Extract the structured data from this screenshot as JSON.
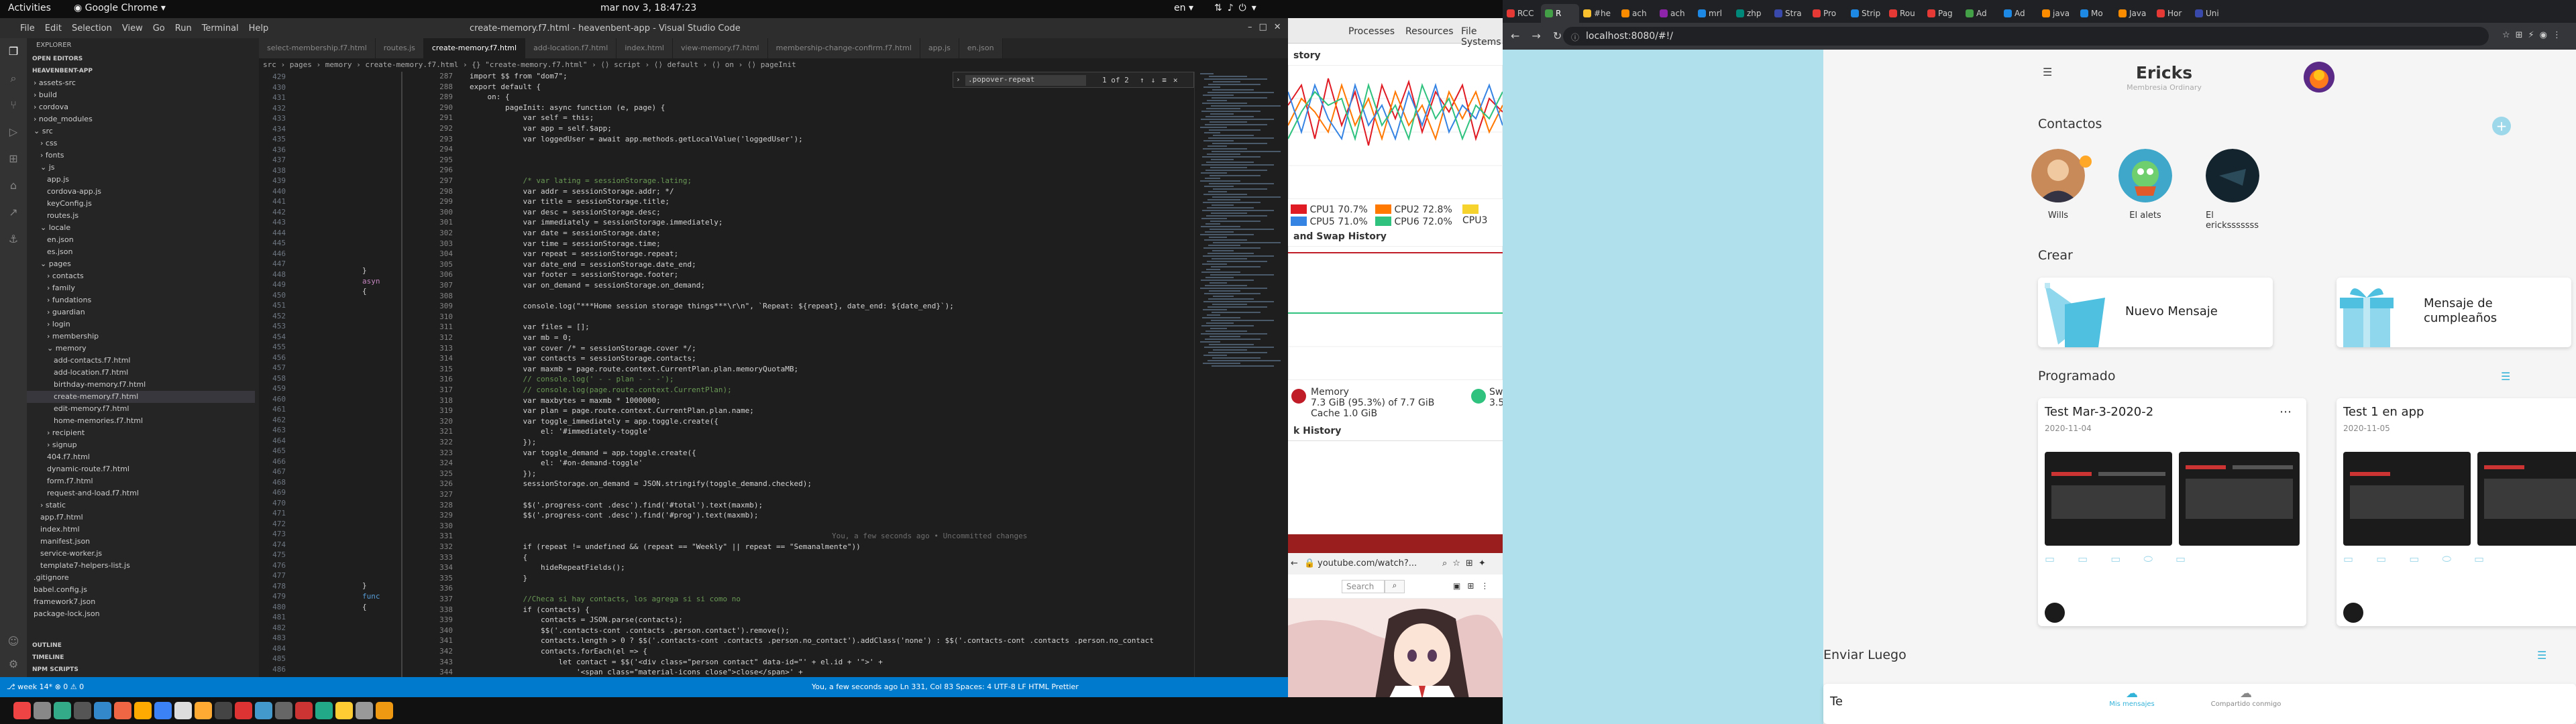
{
  "topbar": {
    "activities": "Activities",
    "app_name": "Google Chrome",
    "clock": "mar nov  3, 18:47:23",
    "lang": "en"
  },
  "vscode": {
    "window_title": "create-memory.f7.html - heavenbent-app - Visual Studio Code",
    "menu": [
      "File",
      "Edit",
      "Selection",
      "View",
      "Go",
      "Run",
      "Terminal",
      "Help"
    ],
    "explorer_title": "EXPLORER",
    "open_editors": "OPEN EDITORS",
    "project": "HEAVENBENT-APP",
    "tree": [
      {
        "label": "› assets-src",
        "depth": 1
      },
      {
        "label": "› build",
        "depth": 1
      },
      {
        "label": "› cordova",
        "depth": 1
      },
      {
        "label": "› node_modules",
        "depth": 1
      },
      {
        "label": "⌄ src",
        "depth": 1
      },
      {
        "label": "› css",
        "depth": 2
      },
      {
        "label": "› fonts",
        "depth": 2
      },
      {
        "label": "⌄ js",
        "depth": 2
      },
      {
        "label": "app.js",
        "depth": 3
      },
      {
        "label": "cordova-app.js",
        "depth": 3
      },
      {
        "label": "keyConfig.js",
        "depth": 3
      },
      {
        "label": "routes.js",
        "depth": 3
      },
      {
        "label": "⌄ locale",
        "depth": 2
      },
      {
        "label": "en.json",
        "depth": 3
      },
      {
        "label": "es.json",
        "depth": 3
      },
      {
        "label": "⌄ pages",
        "depth": 2
      },
      {
        "label": "› contacts",
        "depth": 3
      },
      {
        "label": "› family",
        "depth": 3
      },
      {
        "label": "› fundations",
        "depth": 3
      },
      {
        "label": "› guardian",
        "depth": 3
      },
      {
        "label": "› login",
        "depth": 3
      },
      {
        "label": "› membership",
        "depth": 3
      },
      {
        "label": "⌄ memory",
        "depth": 3
      },
      {
        "label": "add-contacts.f7.html",
        "depth": 4
      },
      {
        "label": "add-location.f7.html",
        "depth": 4
      },
      {
        "label": "birthday-memory.f7.html",
        "depth": 4
      },
      {
        "label": "create-memory.f7.html",
        "depth": 4,
        "selected": true
      },
      {
        "label": "edit-memory.f7.html",
        "depth": 4
      },
      {
        "label": "home-memories.f7.html",
        "depth": 4
      },
      {
        "label": "› recipient",
        "depth": 3
      },
      {
        "label": "› signup",
        "depth": 3
      },
      {
        "label": "404.f7.html",
        "depth": 3
      },
      {
        "label": "dynamic-route.f7.html",
        "depth": 3
      },
      {
        "label": "form.f7.html",
        "depth": 3
      },
      {
        "label": "request-and-load.f7.html",
        "depth": 3
      },
      {
        "label": "› static",
        "depth": 2
      },
      {
        "label": "app.f7.html",
        "depth": 2
      },
      {
        "label": "index.html",
        "depth": 2
      },
      {
        "label": "manifest.json",
        "depth": 2
      },
      {
        "label": "service-worker.js",
        "depth": 2
      },
      {
        "label": "template7-helpers-list.js",
        "depth": 2
      },
      {
        "label": ".gitignore",
        "depth": 1
      },
      {
        "label": "babel.config.js",
        "depth": 1
      },
      {
        "label": "framework7.json",
        "depth": 1
      },
      {
        "label": "package-lock.json",
        "depth": 1
      }
    ],
    "outline": "OUTLINE",
    "timeline": "TIMELINE",
    "npm_scripts": "NPM SCRIPTS",
    "tabs": [
      "select-membership.f7.html",
      "routes.js",
      "create-memory.f7.html",
      "add-location.f7.html",
      "index.html",
      "view-memory.f7.html",
      "membership-change-confirm.f7.html",
      "app.js",
      "en.json"
    ],
    "active_tab": "create-memory.f7.html",
    "breadcrumb": "src › pages › memory › create-memory.f7.html › {} \"create-memory.f7.html\" › ⟨⟩ script › ⟨⟩ default › ⟨⟩ on › ⟨⟩ pageInit",
    "find": {
      "value": ".popover-repeat",
      "count": "1 of 2"
    },
    "code_start_line": 287,
    "code": [
      "import $$ from \"dom7\";",
      "export default {",
      "    on: {",
      "        pageInit: async function (e, page) {",
      "            var self = this;",
      "            var app = self.$app;",
      "            var loggedUser = await app.methods.getLocalValue('loggedUser');",
      "",
      "",
      "",
      "            /* var lating = sessionStorage.lating;",
      "            var addr = sessionStorage.addr; */",
      "            var title = sessionStorage.title;",
      "            var desc = sessionStorage.desc;",
      "            var immediately = sessionStorage.immediately;",
      "            var date = sessionStorage.date;",
      "            var time = sessionStorage.time;",
      "            var repeat = sessionStorage.repeat;",
      "            var date_end = sessionStorage.date_end;",
      "            var footer = sessionStorage.footer;",
      "            var on_demand = sessionStorage.on_demand;",
      "",
      "            console.log(\"***Home session storage things***\\r\\n\", `Repeat: ${repeat}, date_end: ${date_end}`);",
      "",
      "            var files = [];",
      "            var mb = 0;",
      "            var cover /* = sessionStorage.cover */;",
      "            var contacts = sessionStorage.contacts;",
      "            var maxmb = page.route.context.CurrentPlan.plan.memoryQuotaMB;",
      "            // console.log(' - - plan - - -');",
      "            // console.log(page.route.context.CurrentPlan);",
      "            var maxbytes = maxmb * 1000000;",
      "            var plan = page.route.context.CurrentPlan.plan.name;",
      "            var toggle_immediately = app.toggle.create({",
      "                el: '#immediately-toggle'",
      "            });",
      "            var toggle_demand = app.toggle.create({",
      "                el: '#on-demand-toggle'",
      "            });",
      "            sessionStorage.on_demand = JSON.stringify(toggle_demand.checked);",
      "",
      "            $$('.progress-cont .desc').find('#total').text(maxmb);",
      "            $$('.progress-cont .desc').find('#prog').text(maxmb);",
      "",
      "",
      "            if (repeat != undefined && (repeat == \"Weekly\" || repeat == \"Semanalmente\"))",
      "            {",
      "                hideRepeatFields();",
      "            }",
      "",
      "            //Checa si hay contacts, los agrega si si como no",
      "            if (contacts) {",
      "                contacts = JSON.parse(contacts);",
      "                $$('.contacts-cont .contacts .person.contact').remove();",
      "                contacts.length > 0 ? $$('.contacts-cont .contacts .person.no_contact').addClass('none') : $$('.contacts-cont .contacts .person.no_contact",
      "                contacts.forEach(el => {",
      "                    let contact = $$('<div class=\"person contact\" data-id=\"' + el.id + '\">' +",
      "                        '<span class=\"material-icons close\">close</span>' +"
    ],
    "blame": "You, a few seconds ago • Uncommitted changes",
    "status_left": "⎇ week 14*   ⊗ 0 ⚠ 0",
    "status_right": "You, a few seconds ago   Ln 331, Col 83   Spaces: 4   UTF-8   LF   HTML   Prettier"
  },
  "sysmon": {
    "tabs": [
      "Processes",
      "Resources",
      "File Systems"
    ],
    "cpu_history_label": "story",
    "cpus": [
      {
        "label": "CPU1 70.7%",
        "color": "#e01b24"
      },
      {
        "label": "CPU2 72.8%",
        "color": "#ff7800"
      },
      {
        "label": "CPU3",
        "color": "#f6d32d"
      },
      {
        "label": "CPU5 71.0%",
        "color": "#3584e4"
      },
      {
        "label": "CPU6 72.0%",
        "color": "#2ec27e"
      }
    ],
    "mem_history_label": "and Swap History",
    "memory_title": "Memory",
    "memory_value": "7.3 GiB (95.3%) of 7.7 GiB",
    "cache_value": "Cache 1.0 GiB",
    "swap_title": "Swa",
    "swap_value": "3.5",
    "net_history_label": "k History"
  },
  "youtube": {
    "url": "youtube.com/watch?...",
    "search_placeholder": "Search"
  },
  "chrome": {
    "tabs": [
      "RCC",
      "R",
      "#he",
      "ach",
      "ach",
      "mrl",
      "zhp",
      "Stra",
      "Pro",
      "Strip",
      "Rou",
      "Pag",
      "Ad",
      "Ad",
      "java",
      "Mo",
      "Java",
      "Hor",
      "Uni"
    ],
    "tab_colors": [
      "#e53935",
      "#43a047",
      "#fbc02d",
      "#fb8c00",
      "#8e24aa",
      "#1e88e5",
      "#00897b",
      "#3949ab",
      "#e53935",
      "#1e88e5",
      "#e53935",
      "#e53935",
      "#43a047",
      "#1e88e5",
      "#fb8c00",
      "#1e88e5",
      "#fb8c00",
      "#e53935",
      "#3949ab"
    ],
    "active_tab": 1,
    "url": "localhost:8080/#!/"
  },
  "app": {
    "user_name": "Ericks",
    "membership": "Membresia Ordinary",
    "contacts_title": "Contactos",
    "contacts": [
      {
        "name": "Wills",
        "color": "#c98a5a"
      },
      {
        "name": "El alets",
        "color": "#3fa7c9"
      },
      {
        "name": "El ericksssssss",
        "color": "#14242e"
      }
    ],
    "create_title": "Crear",
    "new_message": "Nuevo Mensaje",
    "birthday_message": "Mensaje de cumpleaños",
    "scheduled_title": "Programado",
    "scheduled": [
      {
        "title": "Test Mar-3-2020-2",
        "date": "2020-11-04"
      },
      {
        "title": "Test 1 en app",
        "date": "2020-11-05"
      }
    ],
    "send_later_title": "Enviar Luego",
    "send_later_card": "Te",
    "bottom_nav": [
      "Mis mensajes",
      "Compartido conmigo"
    ],
    "accent": "#34b3d9"
  }
}
